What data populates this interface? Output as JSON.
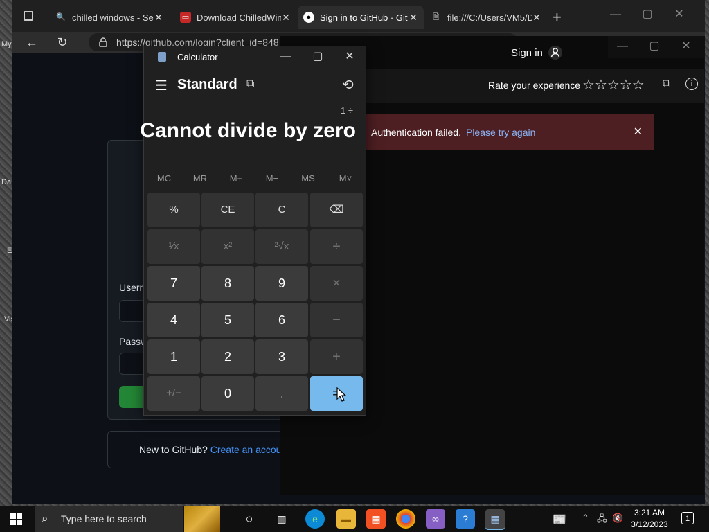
{
  "desktop": {
    "labels": [
      "My",
      "Da",
      "E",
      "Vis"
    ]
  },
  "browser": {
    "tabs": [
      {
        "title": "chilled windows - Sea"
      },
      {
        "title": "Download ChilledWin"
      },
      {
        "title": "Sign in to GitHub · Git"
      },
      {
        "title": "file:///C:/Users/VM5/D"
      }
    ],
    "new_tab": "+",
    "url": "https://github.com/login?client_id=848",
    "back": "←",
    "reload": "↻"
  },
  "github": {
    "username_label": "Usern",
    "password_label": "Passw",
    "new_text": "New to GitHub?",
    "create_link": "Create an accou"
  },
  "rate_window": {
    "signin": "Sign in",
    "rate_label": "Rate your experience",
    "stars": 5,
    "auth_message": "Authentication failed.",
    "auth_link": "Please try again",
    "colors": {
      "link": "#8ab4f8",
      "banner": "#4d1f22"
    }
  },
  "calculator": {
    "title": "Calculator",
    "mode": "Standard",
    "expression": "1 ÷",
    "display": "Cannot divide by zero",
    "memory": [
      "MC",
      "MR",
      "M+",
      "M−",
      "MS",
      "M˅"
    ],
    "keys": [
      [
        "%",
        "CE",
        "C",
        "⌫"
      ],
      [
        "¹⁄x",
        "x²",
        "²√x",
        "÷"
      ],
      [
        "7",
        "8",
        "9",
        "×"
      ],
      [
        "4",
        "5",
        "6",
        "−"
      ],
      [
        "1",
        "2",
        "3",
        "+"
      ],
      [
        "+/−",
        "0",
        ".",
        "="
      ]
    ],
    "colors": {
      "equals": "#76b9ed"
    }
  },
  "taskbar": {
    "search_placeholder": "Type here to search",
    "time": "3:21 AM",
    "date": "3/12/2023",
    "notification_count": "1"
  }
}
